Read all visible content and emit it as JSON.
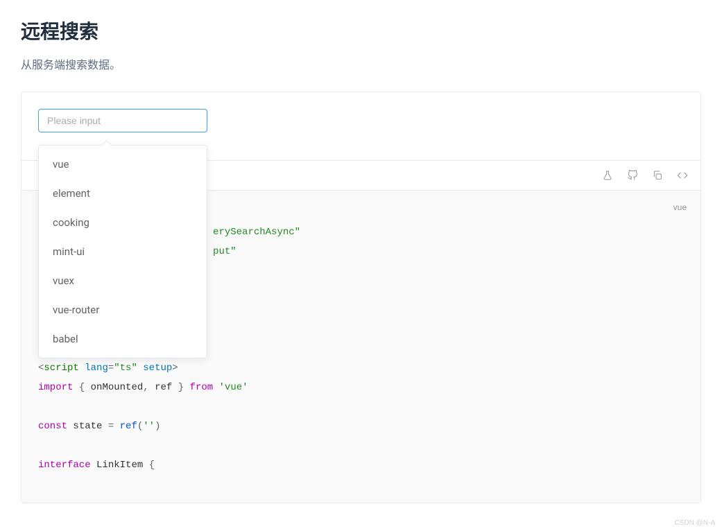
{
  "header": {
    "title": "远程搜索",
    "description": "从服务端搜索数据。"
  },
  "demo": {
    "input_placeholder": "Please input",
    "input_value": "",
    "suggestions": [
      "vue",
      "element",
      "cooking",
      "mint-ui",
      "vuex",
      "vue-router",
      "babel"
    ]
  },
  "code": {
    "language_label": "vue",
    "visible_fragments": {
      "frag_attr1": "erySearchAsync\"",
      "frag_attr2": "put\"",
      "line_script_open": "<script lang=\"ts\" setup>",
      "line_import": "import { onMounted, ref } from 'vue'",
      "line_const": "const state = ref('')",
      "line_interface": "interface LinkItem {"
    }
  },
  "watermark": "CSDN @N-A"
}
